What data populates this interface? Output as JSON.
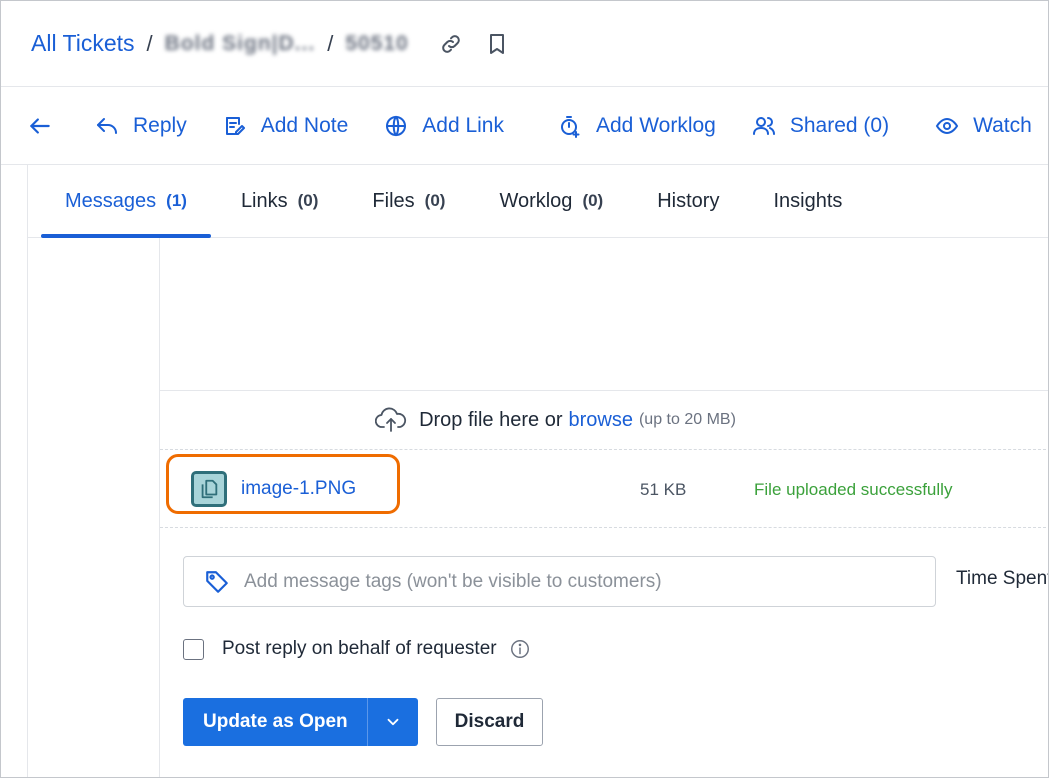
{
  "header": {
    "breadcrumb_root": "All Tickets",
    "separator": "/",
    "breadcrumb_project": "Bold Sign|D...",
    "breadcrumb_ticket": "50510"
  },
  "toolbar": {
    "reply": "Reply",
    "add_note": "Add Note",
    "add_link": "Add Link",
    "add_worklog": "Add Worklog",
    "shared": "Shared (0)",
    "watch": "Watch"
  },
  "tabs": [
    {
      "label": "Messages",
      "count": "(1)",
      "active": true
    },
    {
      "label": "Links",
      "count": "(0)",
      "active": false
    },
    {
      "label": "Files",
      "count": "(0)",
      "active": false
    },
    {
      "label": "Worklog",
      "count": "(0)",
      "active": false
    },
    {
      "label": "History",
      "count": "",
      "active": false
    },
    {
      "label": "Insights",
      "count": "",
      "active": false
    }
  ],
  "dropzone": {
    "text": "Drop file here or",
    "browse": "browse",
    "limit": "(up to 20 MB)"
  },
  "attachment": {
    "name": "image-1.PNG",
    "size": "51 KB",
    "status": "File uploaded successfully"
  },
  "tags_input": {
    "placeholder": "Add message tags (won't be visible to customers)",
    "value": ""
  },
  "time_spent_label": "Time Spent",
  "behalf_label": "Post reply on behalf of requester",
  "buttons": {
    "update": "Update as Open",
    "discard": "Discard"
  },
  "colors": {
    "accent": "#1a5fd6",
    "primary_button": "#1a6fe0",
    "highlight_outline": "#ef6c00",
    "success": "#3ba13b"
  }
}
